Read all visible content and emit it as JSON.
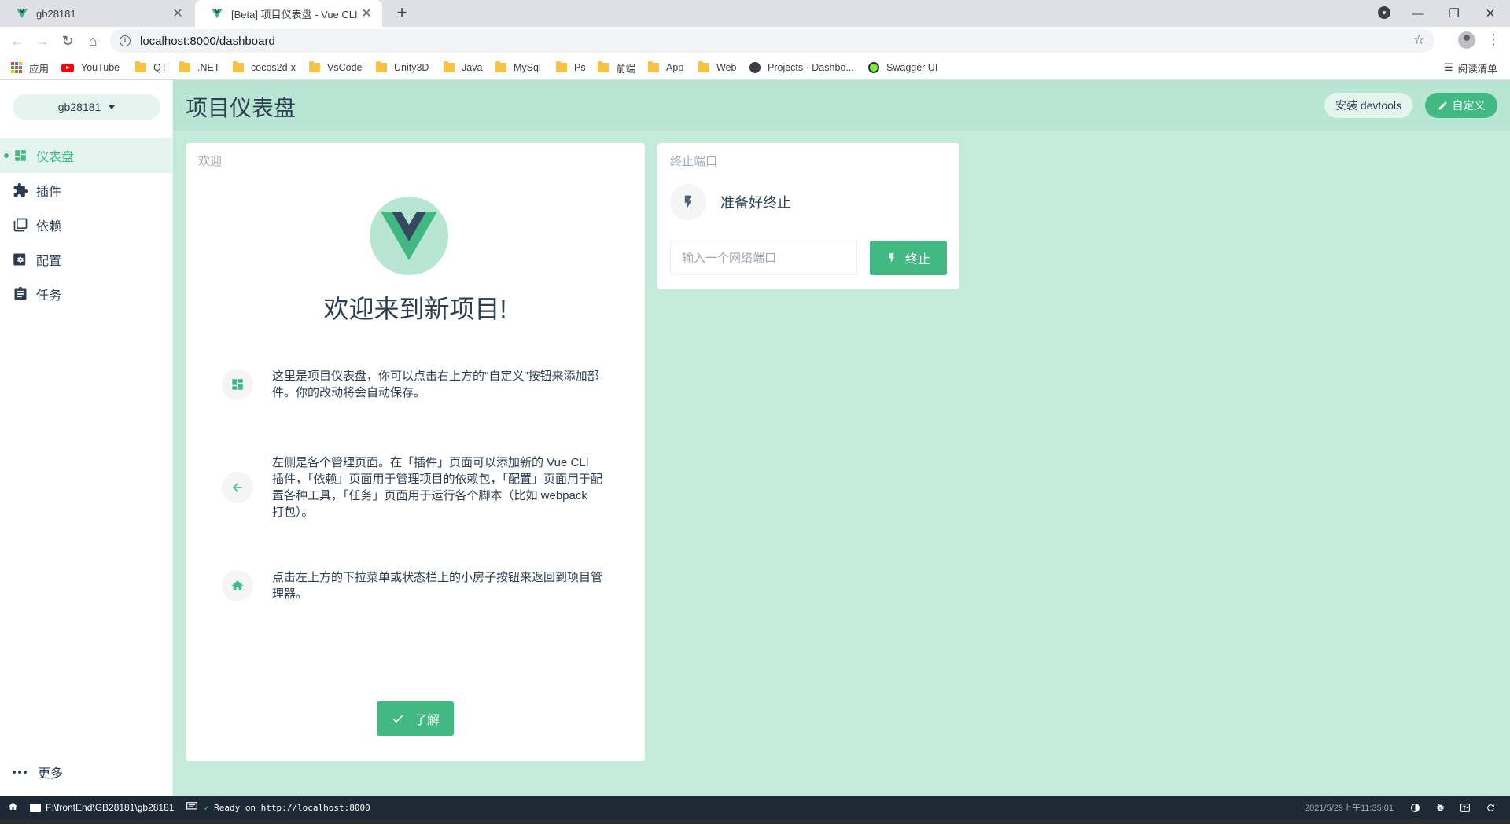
{
  "browser": {
    "tabs": [
      {
        "title": "gb28181",
        "active": false
      },
      {
        "title": "[Beta] 项目仪表盘 - Vue CLI",
        "active": true
      }
    ],
    "url": "localhost:8000/dashboard",
    "bookmarks": [
      "应用",
      "YouTube",
      "QT",
      ".NET",
      "cocos2d-x",
      "VsCode",
      "Unity3D",
      "Java",
      "MySql",
      "Ps",
      "前端",
      "App",
      "Web",
      "Projects · Dashbo...",
      "Swagger UI"
    ],
    "reading_list": "阅读清单"
  },
  "sidebar": {
    "project": "gb28181",
    "items": [
      {
        "label": "仪表盘",
        "icon": "dashboard-icon",
        "active": true
      },
      {
        "label": "插件",
        "icon": "puzzle-icon",
        "active": false
      },
      {
        "label": "依赖",
        "icon": "library-books-icon",
        "active": false
      },
      {
        "label": "配置",
        "icon": "settings-icon",
        "active": false
      },
      {
        "label": "任务",
        "icon": "clipboard-icon",
        "active": false
      }
    ],
    "more": "更多"
  },
  "header": {
    "title": "项目仪表盘",
    "devtools_label": "安装 devtools",
    "customize_label": "自定义"
  },
  "welcome_card": {
    "title": "欢迎",
    "heading": "欢迎来到新项目!",
    "tips": [
      {
        "icon": "dashboard-icon",
        "text": "这里是项目仪表盘，你可以点击右上方的\"自定义\"按钮来添加部件。你的改动将会自动保存。"
      },
      {
        "icon": "arrow-left-icon",
        "text": "左侧是各个管理页面。在「插件」页面可以添加新的 Vue CLI 插件，「依赖」页面用于管理项目的依赖包，「配置」页面用于配置各种工具，「任务」页面用于运行各个脚本（比如 webpack 打包）。"
      },
      {
        "icon": "home-icon",
        "text": "点击左上方的下拉菜单或状态栏上的小房子按钮来返回到项目管理器。"
      }
    ],
    "ok_label": "了解"
  },
  "kill_port_card": {
    "title": "终止端口",
    "status": "准备好终止",
    "input_placeholder": "输入一个网络端口",
    "input_value": "",
    "kill_label": "终止"
  },
  "statusbar": {
    "path": "F:\\frontEnd\\GB28181\\gb28181",
    "log": "Ready on http://localhost:8000",
    "time": "2021/5/29上午11:35:01"
  },
  "colors": {
    "accent": "#42b983",
    "accent_light": "#c4eadb",
    "header_bg": "#b9e6d2",
    "text": "#2c3e50",
    "vue_green": "#41b883",
    "vue_dark": "#35495e"
  }
}
